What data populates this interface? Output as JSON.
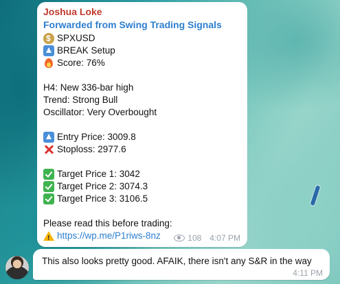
{
  "message1": {
    "sender": "Joshua Loke",
    "forwarded_from": "Forwarded from Swing Trading Signals",
    "lines": [
      {
        "icon": "money-bag-icon",
        "text": "SPXUSD"
      },
      {
        "icon": "up-arrow-icon",
        "text": "BREAK Setup"
      },
      {
        "icon": "fire-icon",
        "text": "Score: 76%"
      },
      {
        "icon": "",
        "text": "H4: New 336-bar high"
      },
      {
        "icon": "",
        "text": "Trend: Strong Bull"
      },
      {
        "icon": "",
        "text": "Oscillator: Very Overbought"
      },
      {
        "icon": "up-arrow-icon",
        "text": "Entry Price: 3009.8"
      },
      {
        "icon": "cross-mark-icon",
        "text": "Stoploss: 2977.6"
      },
      {
        "icon": "check-icon",
        "text": "Target Price 1: 3042"
      },
      {
        "icon": "check-icon",
        "text": "Target Price 2: 3074.3"
      },
      {
        "icon": "check-icon",
        "text": "Target Price 3: 3106.5"
      },
      {
        "icon": "",
        "text": "Please read this before trading:"
      },
      {
        "icon": "warning-icon",
        "text": "https://wp.me/P1riws-8nz"
      }
    ],
    "views": "108",
    "time": "4:07 PM"
  },
  "message2": {
    "text": "This also looks pretty good. AFAIK, there isn't any S&R in the way",
    "time": "4:11 PM"
  },
  "colors": {
    "sender": "#c0392b",
    "forward": "#2d7ecf",
    "link": "#2d7ecf",
    "meta": "#9aa3ab"
  }
}
